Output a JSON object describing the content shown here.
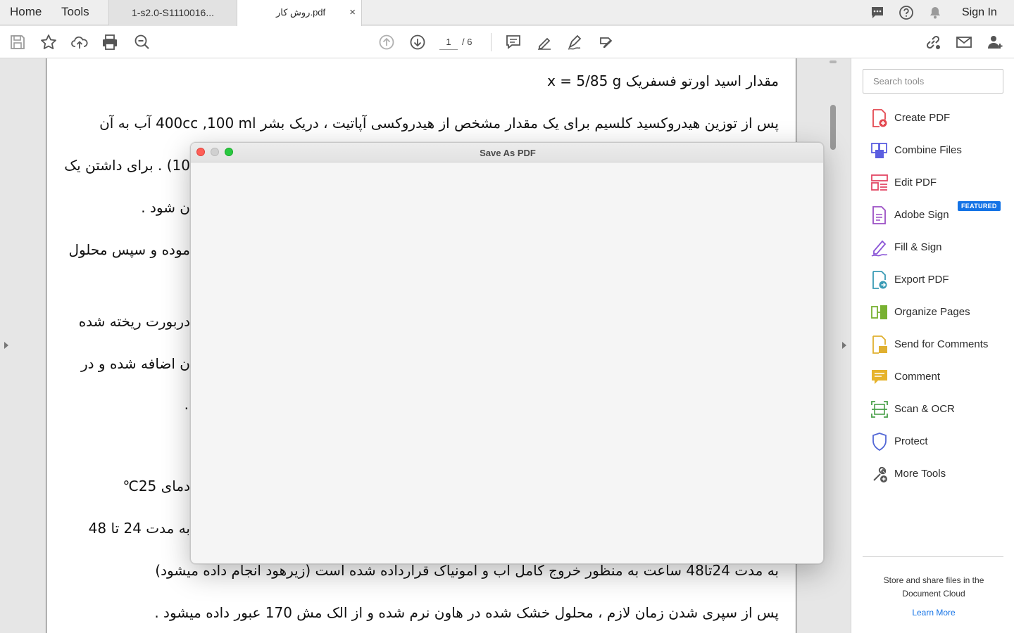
{
  "top_nav": {
    "home": "Home",
    "tools": "Tools"
  },
  "tabs": [
    {
      "label": "1-s2.0-S1110016..."
    },
    {
      "label": "روش کار.pdf",
      "close": "×"
    }
  ],
  "sign_in": "Sign In",
  "toolbar": {
    "current_page": "1",
    "page_total": "/ 6"
  },
  "document": {
    "lines": [
      "مقدار اسید اورتو فسفریک x = 5/85 g",
      "پس از توزین هیدروکسید کلسیم برای یک مقدار مشخص از هیدروکسی آپاتیت ، دریک بشر 400cc ,100 ml آب به آن",
      "به مدت 24تا48 ساعت به منظور خروج کامل آب و امونیاک قرارداده شده است (زیرهود انجام داده میشود)",
      "پس از سپری شدن زمان لازم ، محلول خشک شده در هاون نرم شده و از الک مش 170 عبور داده میشود ."
    ],
    "fragments": [
      "10) . برای داشتن یک",
      "ن شود .",
      "موده و سپس محلول",
      "دربورت ریخته شده",
      "ن اضافه شده و در",
      ".",
      "دمای 25℃",
      "به مدت 24 تا 48"
    ]
  },
  "dialog": {
    "title": "Save As PDF"
  },
  "right_panel": {
    "search_placeholder": "Search tools",
    "featured_badge": "FEATURED",
    "tools": [
      {
        "label": "Create PDF",
        "icon": "create-pdf-icon",
        "color": "#e34850"
      },
      {
        "label": "Combine Files",
        "icon": "combine-files-icon",
        "color": "#5b5ee0"
      },
      {
        "label": "Edit PDF",
        "icon": "edit-pdf-icon",
        "color": "#e34865"
      },
      {
        "label": "Adobe Sign",
        "icon": "adobe-sign-icon",
        "color": "#9b4fc5"
      },
      {
        "label": "Fill & Sign",
        "icon": "fill-sign-icon",
        "color": "#8a55d6"
      },
      {
        "label": "Export PDF",
        "icon": "export-pdf-icon",
        "color": "#3a9bb5"
      },
      {
        "label": "Organize Pages",
        "icon": "organize-pages-icon",
        "color": "#78b131"
      },
      {
        "label": "Send for Comments",
        "icon": "send-comments-icon",
        "color": "#e0b030"
      },
      {
        "label": "Comment",
        "icon": "comment-icon",
        "color": "#e6b32c"
      },
      {
        "label": "Scan & OCR",
        "icon": "scan-ocr-icon",
        "color": "#4aa04a"
      },
      {
        "label": "Protect",
        "icon": "protect-icon",
        "color": "#5368d6"
      },
      {
        "label": "More Tools",
        "icon": "more-tools-icon",
        "color": "#555555"
      }
    ],
    "cloud_text": "Store and share files in the Document Cloud",
    "learn_more": "Learn More"
  }
}
